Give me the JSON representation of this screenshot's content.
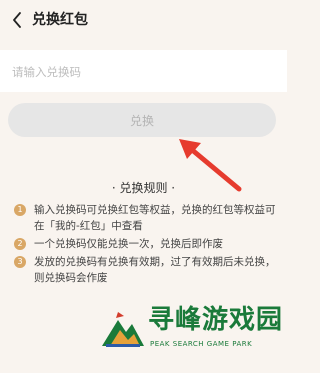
{
  "header": {
    "title": "兑换红包",
    "back_icon": "chevron-left-icon"
  },
  "redeem_input": {
    "value": "",
    "placeholder": "请输入兑换码"
  },
  "redeem_button": {
    "label": "兑换"
  },
  "annotation": {
    "icon": "red-arrow-icon",
    "color": "#e63b2e"
  },
  "rules": {
    "title": "· 兑换规则 ·",
    "items": [
      {
        "number": "1",
        "text": "输入兑换码可兑换红包等权益，兑换的红包等权益可在「我的-红包」中查看"
      },
      {
        "number": "2",
        "text": "一个兑换码仅能兑换一次，兑换后即作废"
      },
      {
        "number": "3",
        "text": "发放的兑换码有兑换有效期，过了有效期后未兑换，则兑换码会作废"
      }
    ]
  },
  "watermark": {
    "title": "寻峰游戏园",
    "subtitle": "PEAK SEARCH GAME PARK"
  },
  "colors": {
    "background": "#f9f4ef",
    "accent": "#d9a766",
    "button_disabled": "#e6e6e6",
    "watermark": "#1a7a3a"
  }
}
